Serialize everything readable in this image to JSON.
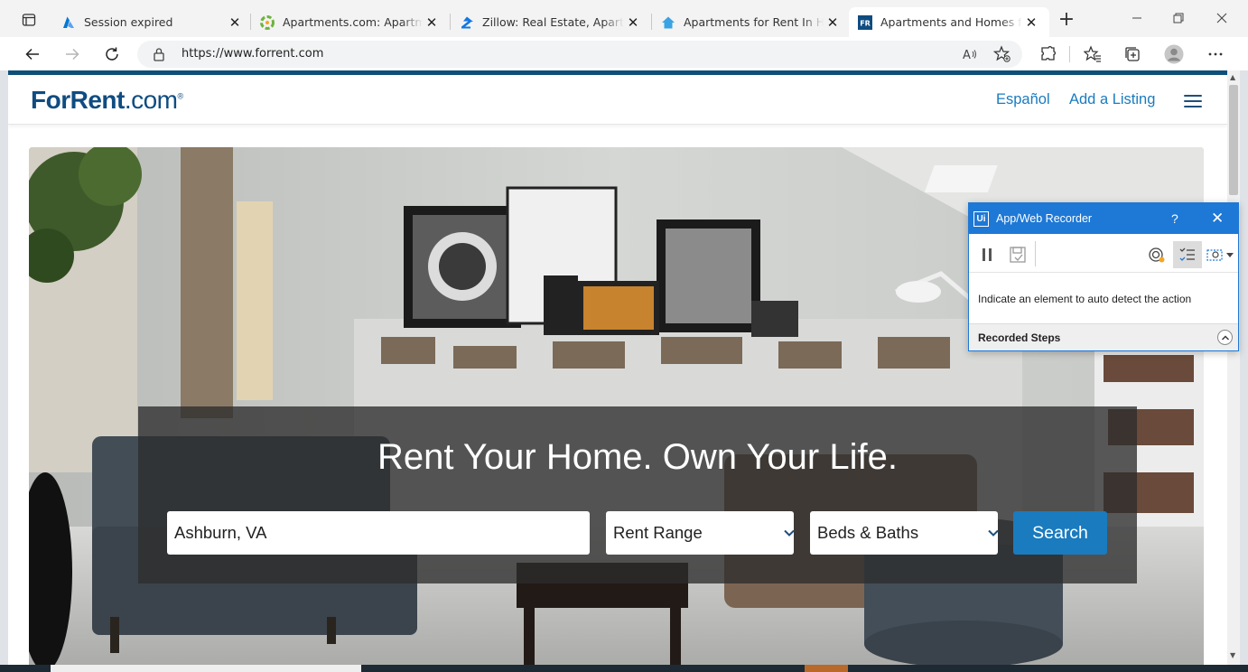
{
  "browser": {
    "tabs": [
      {
        "title": "Session expired",
        "icon": "azure-icon",
        "active": false
      },
      {
        "title": "Apartments.com: Apartments",
        "icon": "apartments-icon",
        "active": false
      },
      {
        "title": "Zillow: Real Estate, Apartment",
        "icon": "zillow-icon",
        "active": false
      },
      {
        "title": "Apartments for Rent In Hartfo",
        "icon": "home-icon",
        "active": false
      },
      {
        "title": "Apartments and Homes for R",
        "icon": "fr-icon",
        "active": true
      }
    ],
    "tab_close_glyph": "✕",
    "new_tab_glyph": "+",
    "url": "https://www.forrent.com"
  },
  "site": {
    "logo_brand": "ForRent",
    "logo_tld": ".com",
    "logo_reg": "®",
    "nav": {
      "espanol": "Español",
      "add_listing": "Add a Listing"
    },
    "hero": {
      "title": "Rent Your Home. Own Your Life.",
      "location_value": "Ashburn, VA",
      "rent_range": "Rent Range",
      "beds_baths": "Beds & Baths",
      "search_label": "Search"
    },
    "colors": {
      "brand": "#0f4c81",
      "link": "#1a7bbf",
      "search_button": "#1a7bbf"
    }
  },
  "recorder": {
    "title": "App/Web Recorder",
    "logo": "Ui",
    "help": "?",
    "close": "✕",
    "message": "Indicate an element to auto detect the action",
    "steps_label": "Recorded Steps",
    "accent": "#1e78d6"
  }
}
